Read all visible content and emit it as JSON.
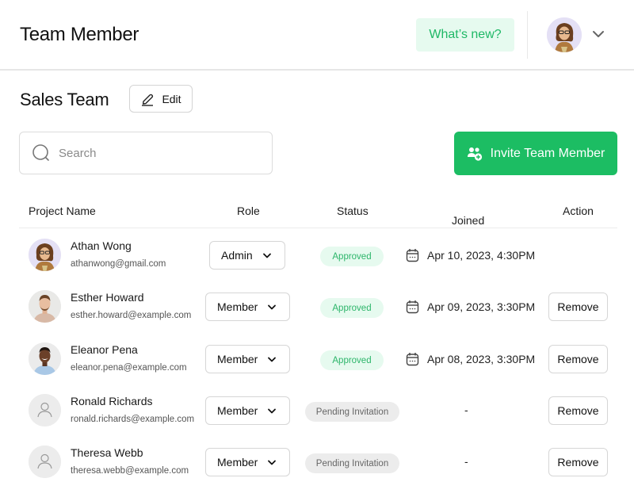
{
  "header": {
    "title": "Team Member",
    "whats_new_label": "What’s new?",
    "profile_icon": "user-avatar-photo",
    "chevron_icon": "chevron-down-icon"
  },
  "team": {
    "name": "Sales Team",
    "edit_label": "Edit",
    "edit_icon": "pencil-icon"
  },
  "search": {
    "placeholder": "Search",
    "value": "",
    "icon": "search-icon"
  },
  "invite": {
    "label": "Invite Team Member",
    "icon": "add-users-icon"
  },
  "colors": {
    "accent": "#1cbd63",
    "approved_bg": "#e6faef",
    "approved_text": "#2cb56a",
    "pending_bg": "#ececec",
    "pending_text": "#666666"
  },
  "table": {
    "columns": [
      "Project Name",
      "Role",
      "Status",
      "Joined",
      "Action"
    ],
    "rows": [
      {
        "name": "Athan Wong",
        "email": "athanwong@gmail.com",
        "avatar": "photo-woman-glasses",
        "role": "Admin",
        "status": "Approved",
        "joined": "Apr 10, 2023, 4:30PM",
        "action": ""
      },
      {
        "name": "Esther Howard",
        "email": "esther.howard@example.com",
        "avatar": "photo-man-beard",
        "role": "Member",
        "status": "Approved",
        "joined": "Apr 09, 2023, 3:30PM",
        "action": "Remove"
      },
      {
        "name": "Eleanor Pena",
        "email": "eleanor.pena@example.com",
        "avatar": "photo-man-smiling",
        "role": "Member",
        "status": "Approved",
        "joined": "Apr 08, 2023, 3:30PM",
        "action": "Remove"
      },
      {
        "name": "Ronald Richards",
        "email": "ronald.richards@example.com",
        "avatar": "placeholder-user-icon",
        "role": "Member",
        "status": "Pending Invitation",
        "joined": "-",
        "action": "Remove"
      },
      {
        "name": "Theresa Webb",
        "email": "theresa.webb@example.com",
        "avatar": "placeholder-user-icon",
        "role": "Member",
        "status": "Pending Invitation",
        "joined": "-",
        "action": "Remove"
      }
    ]
  }
}
